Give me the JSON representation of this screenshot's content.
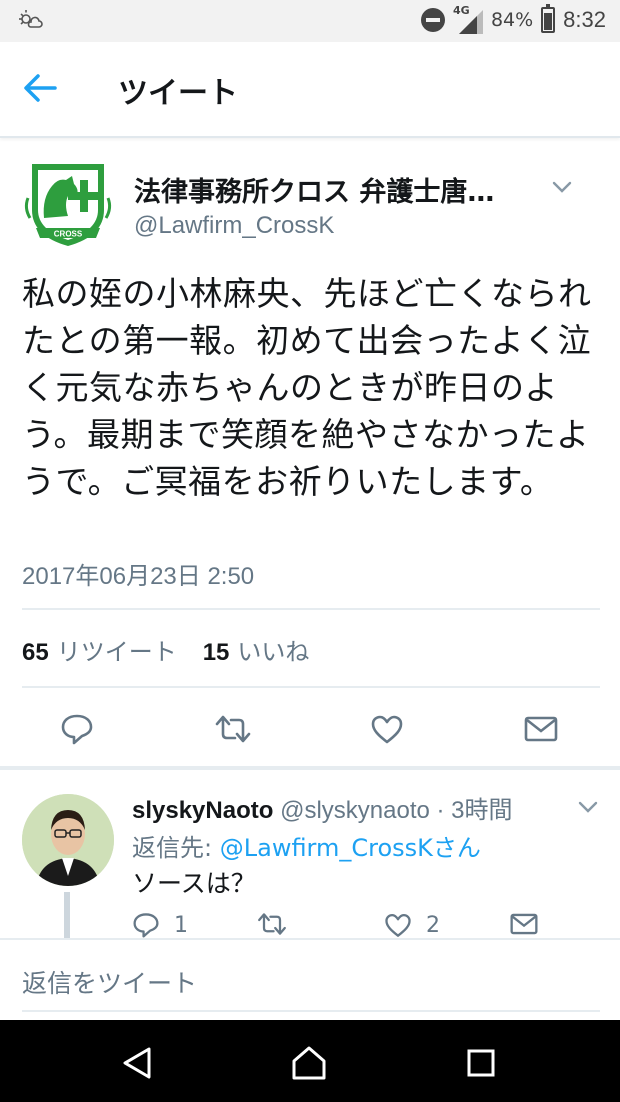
{
  "status_bar": {
    "network_label": "4G",
    "battery_percent": "84%",
    "battery_level": 0.84,
    "time": "8:32"
  },
  "app_bar": {
    "title": "ツイート",
    "back_icon": "arrow-left-icon"
  },
  "tweet": {
    "author_name": "法律事務所クロス 弁護士唐…",
    "author_handle": "@Lawfirm_CrossK",
    "logo_text": "CROSS",
    "text": "私の姪の小林麻央、先ほど亡くなられたとの第一報。初めて出会ったよく泣く元気な赤ちゃんのときが昨日のよう。最期まで笑顔を絶やさなかったようで。ご冥福をお祈りいたします。",
    "timestamp": "2017年06月23日 2:50",
    "retweet_count": "65",
    "retweet_label": "リツイート",
    "like_count": "15",
    "like_label": "いいね"
  },
  "reply": {
    "name": "slyskyNaoto",
    "handle": "@slyskynaoto",
    "time": "· 3時間",
    "reply_to_label": "返信先:",
    "reply_to_mention": "@Lawfirm_CrossKさん",
    "text": "ソースは？",
    "reply_count": "1",
    "like_count": "2"
  },
  "compose": {
    "placeholder": "返信をツイート"
  },
  "colors": {
    "accent": "#1da1f2",
    "logo_green": "#2e9e3e",
    "secondary_text": "#657786"
  }
}
